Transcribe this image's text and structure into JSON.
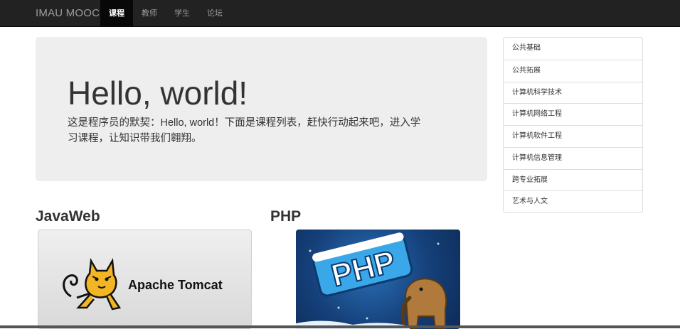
{
  "navbar": {
    "brand": "IMAU MOOC",
    "items": [
      {
        "label": "课程",
        "active": true
      },
      {
        "label": "教师",
        "active": false
      },
      {
        "label": "学生",
        "active": false
      },
      {
        "label": "论坛",
        "active": false
      }
    ]
  },
  "jumbotron": {
    "title": "Hello, world!",
    "text_line1": "这是程序员的默契：Hello, world！下面是课程列表，赶快行动起来吧，进入学",
    "text_line2": "习课程，让知识带我们翱翔。"
  },
  "sidebar": {
    "items": [
      {
        "label": "公共基础"
      },
      {
        "label": "公共拓展"
      },
      {
        "label": "计算机科学技术"
      },
      {
        "label": "计算机网络工程"
      },
      {
        "label": "计算机软件工程"
      },
      {
        "label": "计算机信息管理"
      },
      {
        "label": "跨专业拓展"
      },
      {
        "label": "艺术与人文"
      }
    ]
  },
  "courses": [
    {
      "title": "JavaWeb",
      "image_text": "Apache Tomcat",
      "icon": "tomcat-logo-icon"
    },
    {
      "title": "PHP",
      "image_text": "PHP",
      "icon": "php-elephant-icon"
    }
  ]
}
